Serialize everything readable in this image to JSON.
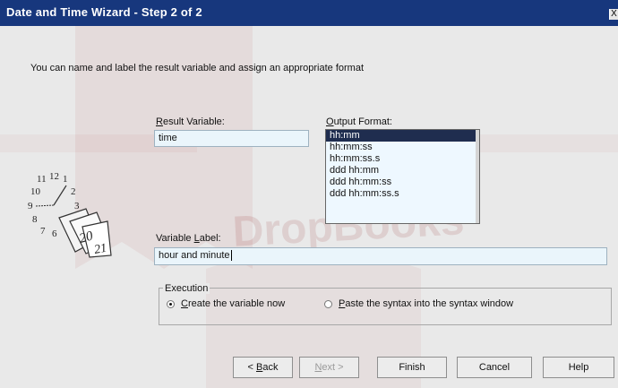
{
  "window": {
    "title": "Date and Time Wizard - Step 2 of 2",
    "close_glyph": "X"
  },
  "intro_text": "You can name and label the result variable and assign an appropriate format",
  "result_variable": {
    "label_accel": "R",
    "label_rest": "esult Variable:",
    "value": "time"
  },
  "output_format": {
    "label_accel": "O",
    "label_rest": "utput Format:",
    "options": [
      "hh:mm",
      "hh:mm:ss",
      "hh:mm:ss.s",
      "ddd hh:mm",
      "ddd hh:mm:ss",
      "ddd hh:mm:ss.s"
    ],
    "selected_index": 0
  },
  "variable_label": {
    "label_pre": "Variable ",
    "label_accel": "L",
    "label_rest": "abel:",
    "value": "hour and minute"
  },
  "execution": {
    "title": "Execution",
    "create_now": {
      "accel": "C",
      "rest": "reate the variable now",
      "checked": true
    },
    "paste_syntax": {
      "accel": "P",
      "rest": "aste the syntax into the syntax window",
      "checked": false
    }
  },
  "buttons": {
    "back": {
      "prefix": "< ",
      "accel": "B",
      "rest": "ack"
    },
    "next": {
      "accel": "N",
      "rest": "ext >"
    },
    "finish": "Finish",
    "cancel": "Cancel",
    "help": "Help"
  },
  "clock": {
    "numbers": [
      "11",
      "12",
      "1",
      "10",
      "2",
      "9",
      "3",
      "8",
      "7",
      "6"
    ],
    "calendar_pages": [
      "20",
      "21"
    ]
  },
  "watermark": {
    "text": "DropBooks"
  },
  "colors": {
    "titlebar": "#17377d",
    "selection": "#1f2d4f",
    "field_bg": "#eaf5fb",
    "watermark": "#b23a3a"
  }
}
